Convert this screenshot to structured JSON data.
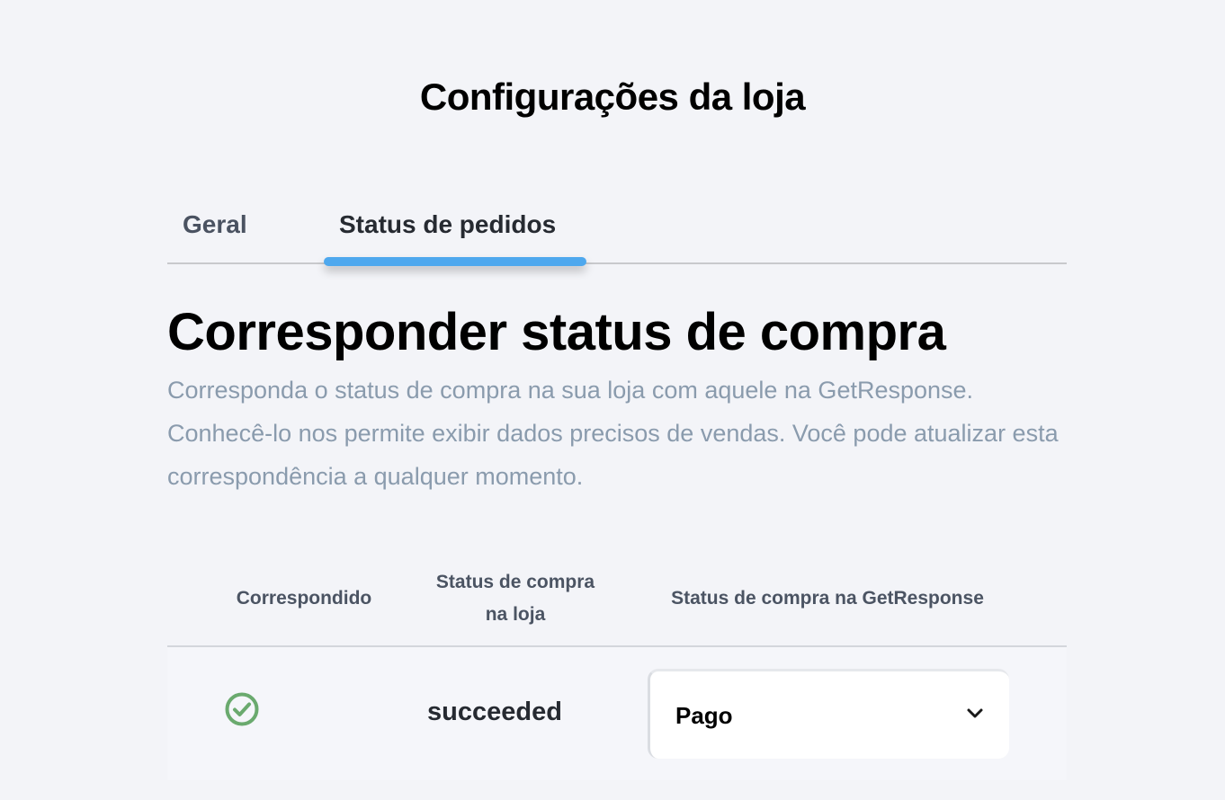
{
  "page": {
    "title": "Configurações da loja"
  },
  "tabs": [
    {
      "label": "Geral",
      "active": false
    },
    {
      "label": "Status de pedidos",
      "active": true
    }
  ],
  "section": {
    "heading": "Corresponder status de compra",
    "description": "Corresponda o status de compra na sua loja com aquele na GetResponse. Conhecê-lo nos permite exibir dados precisos de vendas. Você pode atualizar esta correspondência a qualquer momento."
  },
  "table": {
    "headers": {
      "matched": "Correspondido",
      "store_status": "Status de compra na loja",
      "gr_status": "Status de compra na GetResponse"
    },
    "rows": [
      {
        "matched_icon": "check-circle-icon",
        "store_status": "succeeded",
        "gr_status": "Pago"
      }
    ]
  },
  "colors": {
    "accent": "#4ea8ee",
    "success": "#6aaa6e",
    "muted_text": "#8a9bad"
  }
}
